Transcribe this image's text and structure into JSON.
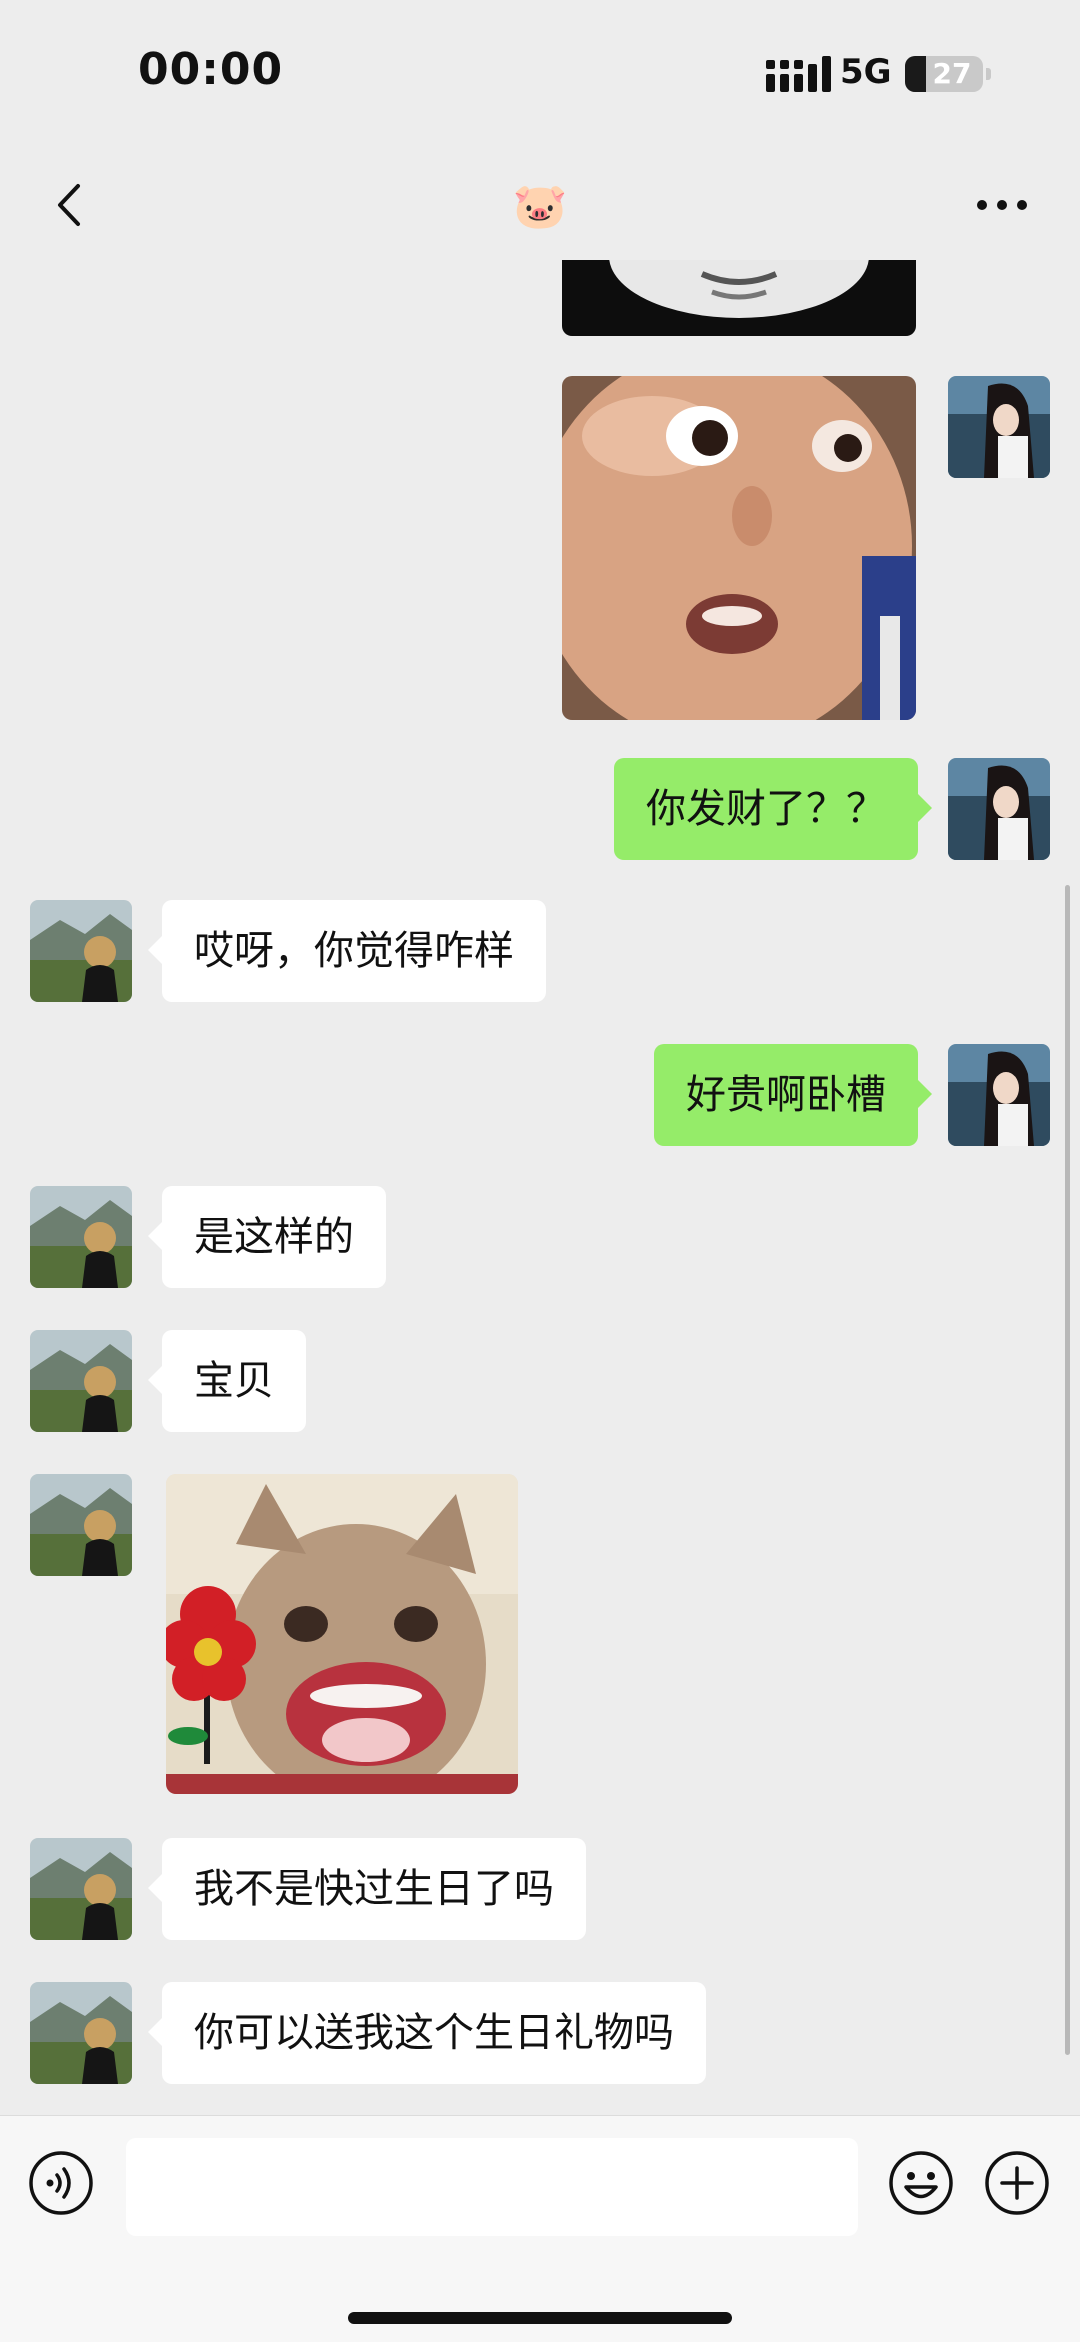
{
  "status_bar": {
    "time": "00:00",
    "network": "5G",
    "battery": "27",
    "battery_level": 0.27
  },
  "header": {
    "title": "🐷",
    "back_icon": "back-arrow-icon",
    "more_icon": "more-dots-icon"
  },
  "messages": [
    {
      "from": "me",
      "type": "image",
      "content": "image"
    },
    {
      "from": "me",
      "type": "image",
      "content": "image"
    },
    {
      "from": "me",
      "type": "text",
      "text": "你发财了？？"
    },
    {
      "from": "other",
      "type": "text",
      "text": "哎呀，你觉得咋样"
    },
    {
      "from": "me",
      "type": "text",
      "text": "好贵啊卧槽"
    },
    {
      "from": "other",
      "type": "text",
      "text": "是这样的"
    },
    {
      "from": "other",
      "type": "text",
      "text": "宝贝"
    },
    {
      "from": "other",
      "type": "image",
      "content": "image"
    },
    {
      "from": "other",
      "type": "text",
      "text": "我不是快过生日了吗"
    },
    {
      "from": "other",
      "type": "text",
      "text": "你可以送我这个生日礼物吗"
    }
  ],
  "input_bar": {
    "value": "",
    "voice_icon": "voice-icon",
    "emoji_icon": "emoji-icon",
    "plus_icon": "plus-icon"
  },
  "colors": {
    "background": "#ededed",
    "outgoing_bubble": "#95ec69",
    "incoming_bubble": "#ffffff"
  }
}
